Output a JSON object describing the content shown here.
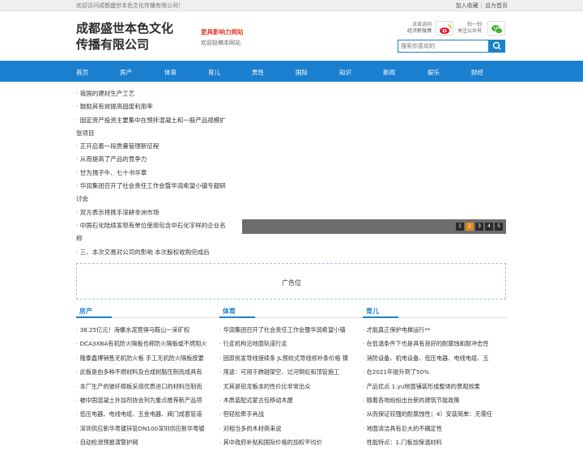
{
  "topbar": {
    "welcome": "欢迎访问成都盛世本色文化传播有限公司！",
    "favorite": "加入收藏",
    "separator": "|",
    "homepage": "设为首页"
  },
  "header": {
    "logo_line1": "成都盛世本色文化",
    "logo_line2": "传播有限公司",
    "slogan": "更具影响力网站",
    "subslogan": "欢迎投稿本网站",
    "weibo_text_1": "点击访问",
    "weibo_text_2": "经济新微博",
    "weixin_text_1": "扫一扫",
    "weixin_text_2": "关注公众号",
    "search_placeholder": "搜索你喜欢的"
  },
  "nav": {
    "items": [
      "首页",
      "房产",
      "体育",
      "育儿",
      "男性",
      "国际",
      "知识",
      "新闻",
      "娱乐",
      "财经"
    ]
  },
  "news_list": [
    "我国的建材生产工艺",
    "鼓励其有效提高固废利用率",
    "固定资产投资主要集中在预拌混凝土和一般产品规模扩",
    "张项目",
    "正开启着一段质量管理新征程",
    "从而提高了产品的竞争力",
    "甘为孺子牛、七十书华章",
    "华润集团召开了社会责任工作会暨华润希望小镇专题研",
    "讨会",
    "双方表示将携手深耕非洲市场",
    "中国石化陆续发现有单位使用包含中石化字样的企业名",
    "称",
    "三、本次交易对公司的影响 本次股权收购完成后"
  ],
  "slider": {
    "pages": [
      "1",
      "2",
      "3",
      "4",
      "5"
    ],
    "active_page": "2"
  },
  "ad": {
    "label": "广告位"
  },
  "columns": [
    {
      "title": "房产",
      "items": [
        "38.25亿元！海螺水泥竟得马鞍山一采矿权",
        "DCA3XBA有机防火隔板也称防火隔板或不燃阻火",
        "隆泰鑫博销售无机防火板 手工无机防火隔板按要",
        "此板是由多种不燃材料及合成树脂压制而成具有",
        "本厂生产的玻纤棉板采用优质进口的材料压制而",
        "被中国混凝土外加剂协会列为重点推荐新产品项",
        "低压电器、电线电缆、五金电器、阀门成套管道",
        "深圳供应新华粤镀锌管DN100深圳供应新华粤镀",
        "自动检测预报演警护网"
      ]
    },
    {
      "title": "体育",
      "items": [
        "华润集团召开了社会责任工作会暨华润希望小镇",
        "行走机构沿地面轨道行走",
        "固原批发导线接续条 JL预绞式导线修补条价格 铸",
        "用途：可用于跨越架空、过河倒虹和顶管施工",
        "尤其是铝龙板本的性价比非常出众",
        "木质装配式蒙古包移动木屋",
        "但轻松牵手肖战",
        "对相当多的木材商来说",
        "其中政府补贴和国际价格的加权平均价"
      ]
    },
    {
      "title": "育儿",
      "items": [
        "才能真正保护电梯运行**",
        "在低温条件下也是具有良好的耐腐蚀和耐冲击性",
        "消防设备、机电设备、低压电器、电线电缆、五",
        "在2021年提升到了50%",
        "产品优点 1.yu地面铺装形成整体的景观效果",
        "随着各地纷纷出台新的建筑节能政策",
        "从而保证较强的耐腐蚀性；4）安装简单：无需任",
        "地面清洁具有巨大的不确定性",
        "性能特点：1.门板加保温材料"
      ]
    }
  ],
  "colors": {
    "nav_blue": "#1b7fd0",
    "slogan_red": "#e53b2c",
    "pager_active": "#e28a1d"
  }
}
